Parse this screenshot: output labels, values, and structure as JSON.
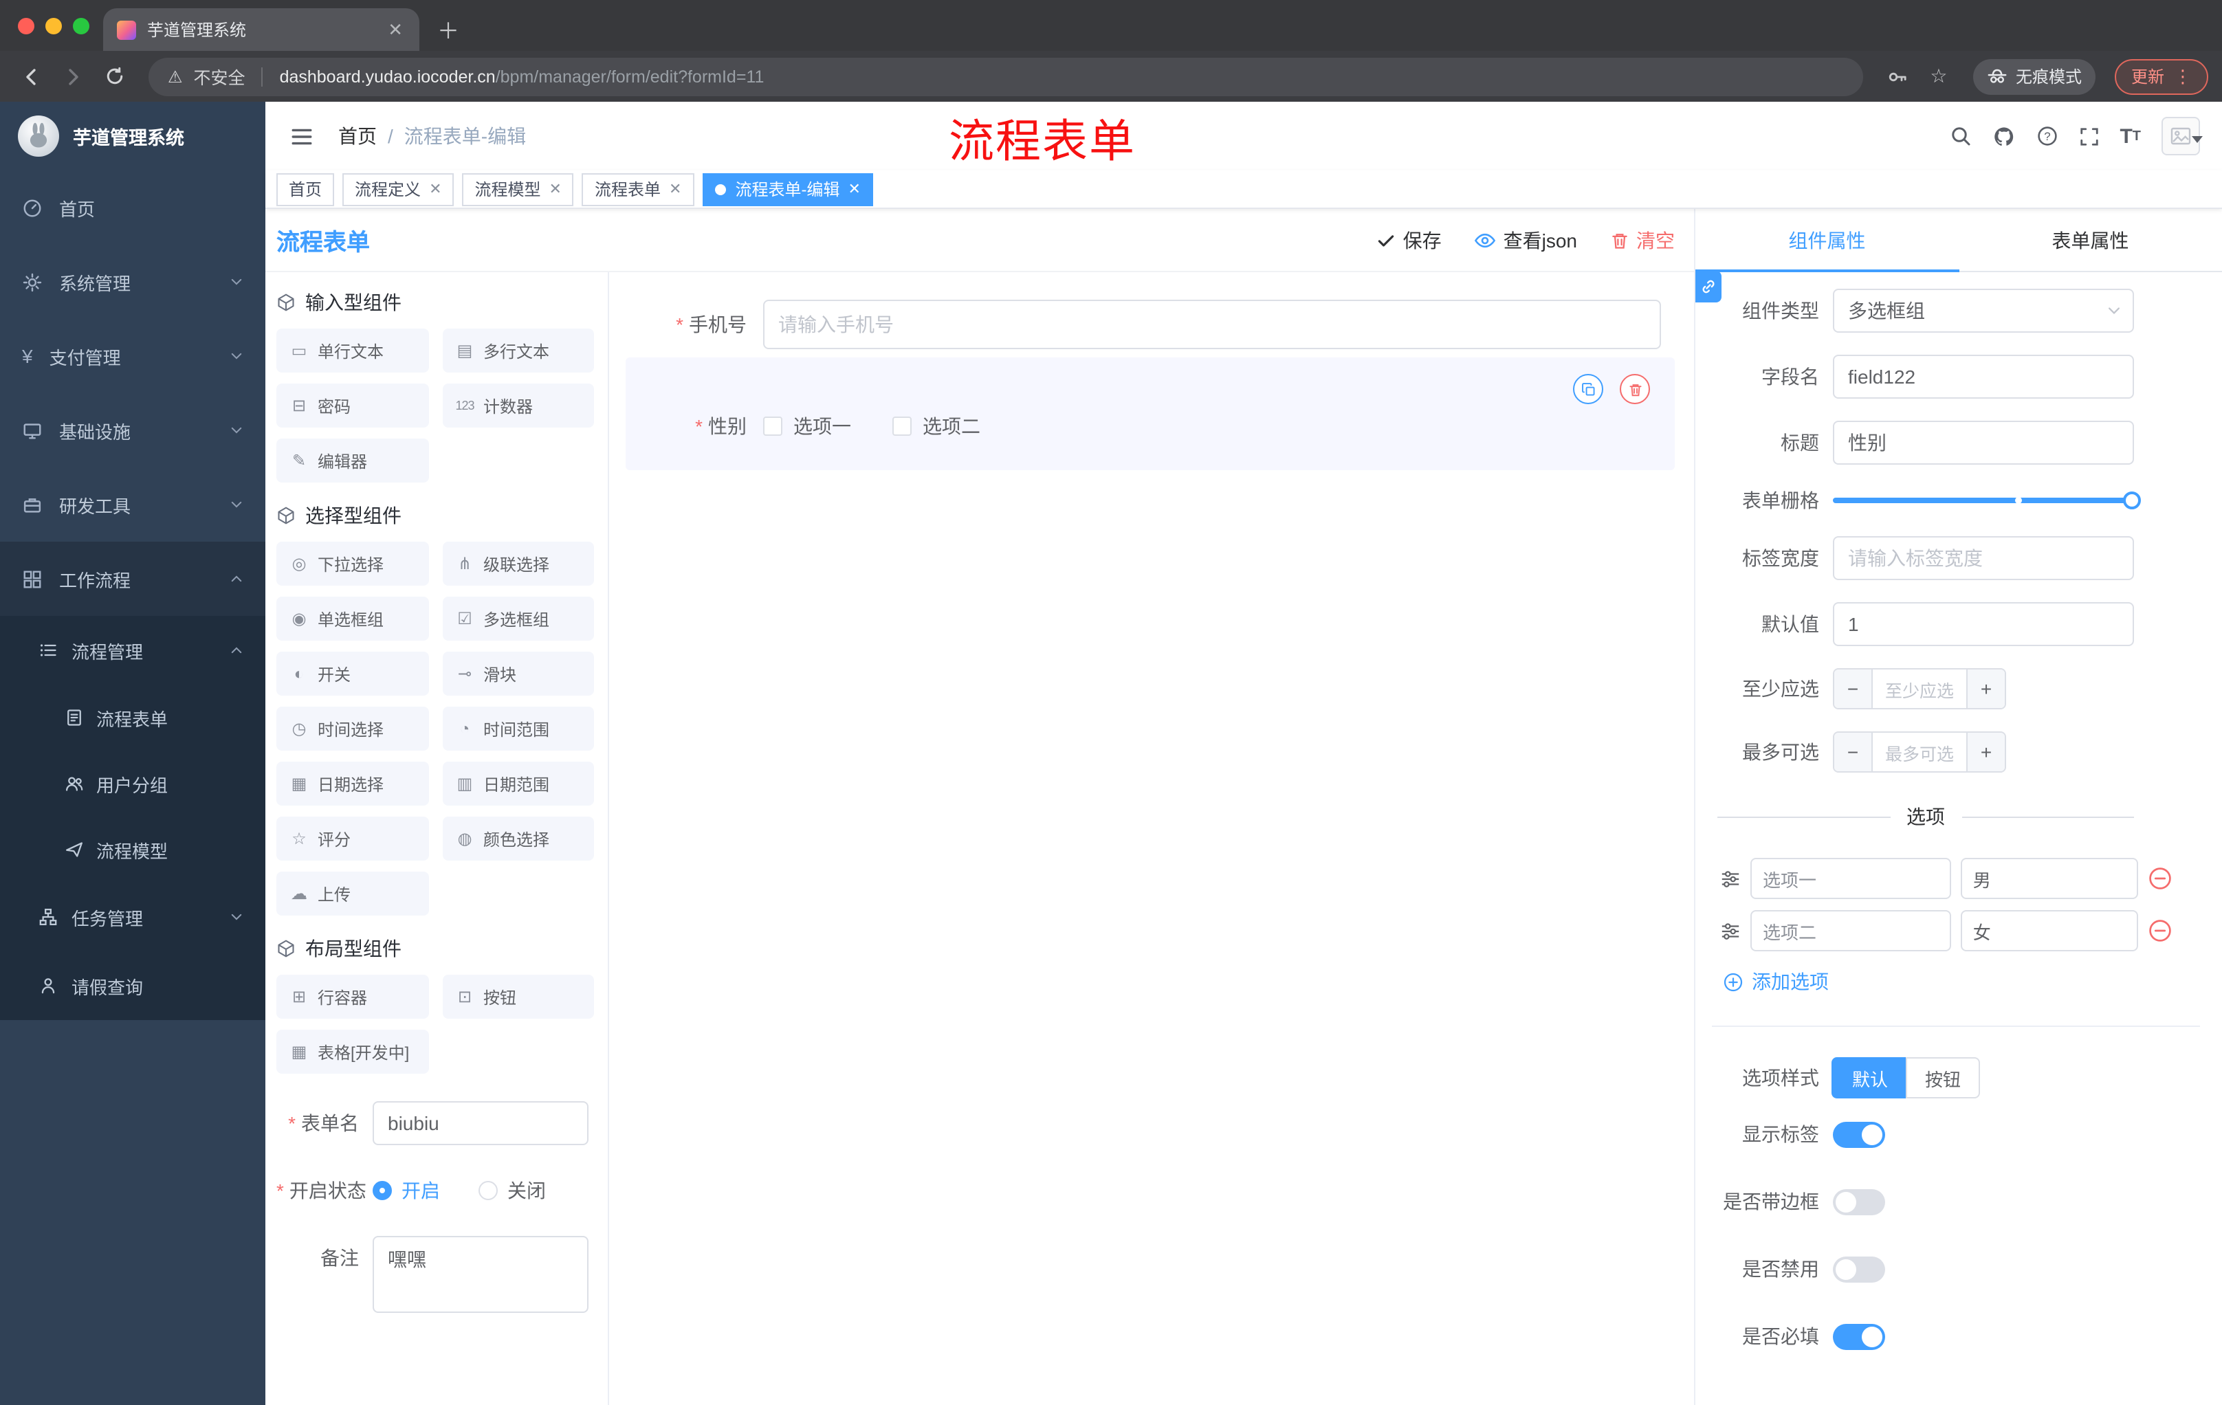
{
  "colors": {
    "accent": "#409EFF",
    "danger": "#F56C6C",
    "sidebar_bg": "#304156",
    "submenu_bg": "#1F2D3D",
    "annotation": "#FF0000"
  },
  "browser": {
    "tab_title": "芋道管理系统",
    "security_label": "不安全",
    "url_host": "dashboard.yudao.iocoder.cn",
    "url_path": "/bpm/manager/form/edit?formId=11",
    "incognito_label": "无痕模式",
    "update_label": "更新"
  },
  "sidebar": {
    "logo_title": "芋道管理系统",
    "items": [
      "首页",
      "系统管理",
      "支付管理",
      "基础设施",
      "研发工具",
      "工作流程"
    ],
    "submenu": {
      "title": "流程管理",
      "children": [
        "流程表单",
        "用户分组",
        "流程模型"
      ],
      "task": "任务管理",
      "leave": "请假查询"
    }
  },
  "navbar": {
    "breadcrumb": [
      "首页",
      "流程表单-编辑"
    ],
    "annotation": "流程表单"
  },
  "tags": [
    {
      "label": "首页"
    },
    {
      "label": "流程定义"
    },
    {
      "label": "流程模型"
    },
    {
      "label": "流程表单"
    },
    {
      "label": "流程表单-编辑"
    }
  ],
  "designer": {
    "title": "流程表单",
    "actions": {
      "save": "保存",
      "view_json": "查看json",
      "clear": "清空"
    },
    "palette": {
      "sections": [
        {
          "title": "输入型组件",
          "items": [
            {
              "icon": "▭",
              "label": "单行文本"
            },
            {
              "icon": "▤",
              "label": "多行文本"
            },
            {
              "icon": "⊟",
              "label": "密码"
            },
            {
              "icon": "123",
              "label": "计数器"
            },
            {
              "icon": "✎",
              "label": "编辑器"
            }
          ]
        },
        {
          "title": "选择型组件",
          "items": [
            {
              "icon": "◎",
              "label": "下拉选择"
            },
            {
              "icon": "⋔",
              "label": "级联选择"
            },
            {
              "icon": "◉",
              "label": "单选框组"
            },
            {
              "icon": "☑",
              "label": "多选框组"
            },
            {
              "icon": "◐",
              "label": "开关"
            },
            {
              "icon": "⊸",
              "label": "滑块"
            },
            {
              "icon": "◷",
              "label": "时间选择"
            },
            {
              "icon": "◔",
              "label": "时间范围"
            },
            {
              "icon": "▦",
              "label": "日期选择"
            },
            {
              "icon": "▥",
              "label": "日期范围"
            },
            {
              "icon": "☆",
              "label": "评分"
            },
            {
              "icon": "◍",
              "label": "颜色选择"
            },
            {
              "icon": "☁",
              "label": "上传"
            }
          ]
        },
        {
          "title": "布局型组件",
          "items": [
            {
              "icon": "⊞",
              "label": "行容器"
            },
            {
              "icon": "⊡",
              "label": "按钮"
            },
            {
              "icon": "▦",
              "label": "表格[开发中]"
            }
          ]
        }
      ]
    },
    "meta": {
      "name_label": "表单名",
      "name_value": "biubiu",
      "status_label": "开启状态",
      "status_on": "开启",
      "status_off": "关闭",
      "remark_label": "备注",
      "remark_value": "嘿嘿"
    },
    "canvas": {
      "phone_label": "手机号",
      "phone_placeholder": "请输入手机号",
      "gender_label": "性别",
      "gender_options": [
        "选项一",
        "选项二"
      ]
    }
  },
  "props": {
    "tabs": [
      "组件属性",
      "表单属性"
    ],
    "component_type_label": "组件类型",
    "component_type_value": "多选框组",
    "field_label": "字段名",
    "field_value": "field122",
    "title_label": "标题",
    "title_value": "性别",
    "grid_label": "表单栅格",
    "label_width_label": "标签宽度",
    "label_width_placeholder": "请输入标签宽度",
    "default_label": "默认值",
    "default_value": "1",
    "min_label": "至少应选",
    "min_placeholder": "至少应选",
    "max_label": "最多可选",
    "max_placeholder": "最多可选",
    "options_title": "选项",
    "options": [
      {
        "label": "选项一",
        "value": "男"
      },
      {
        "label": "选项二",
        "value": "女"
      }
    ],
    "add_option": "添加选项",
    "style_label": "选项样式",
    "style_default": "默认",
    "style_button": "按钮",
    "switches": [
      {
        "label": "显示标签"
      },
      {
        "label": "是否带边框"
      },
      {
        "label": "是否禁用"
      },
      {
        "label": "是否必填"
      }
    ]
  }
}
